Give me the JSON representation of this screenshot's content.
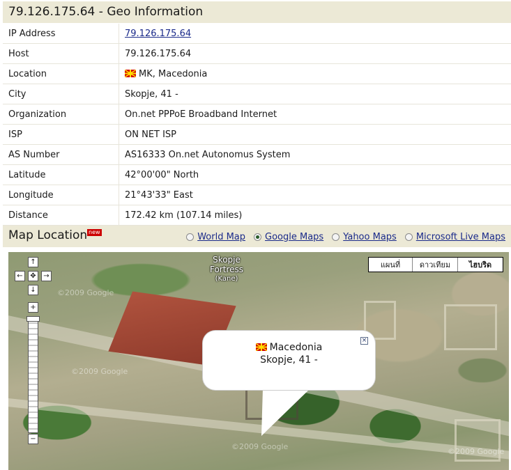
{
  "page_title": "79.126.175.64 - Geo Information",
  "info_rows": [
    {
      "label": "IP Address",
      "value": "79.126.175.64"
    },
    {
      "label": "Host",
      "value": "79.126.175.64"
    },
    {
      "label": "Location",
      "value": "MK, Macedonia"
    },
    {
      "label": "City",
      "value": "Skopje, 41 -"
    },
    {
      "label": "Organization",
      "value": "On.net PPPoE Broadband Internet"
    },
    {
      "label": "ISP",
      "value": "ON NET ISP"
    },
    {
      "label": "AS Number",
      "value": "AS16333 On.net Autonomus System"
    },
    {
      "label": "Latitude",
      "value": "42°00'00\" North"
    },
    {
      "label": "Longitude",
      "value": "21°43'33\" East"
    },
    {
      "label": "Distance",
      "value": "172.42 km (107.14 miles)"
    }
  ],
  "map_section": {
    "title": "Map Location",
    "badge": "new",
    "options": [
      {
        "label": "World Map",
        "checked": false
      },
      {
        "label": "Google Maps",
        "checked": true
      },
      {
        "label": "Yahoo Maps",
        "checked": false
      },
      {
        "label": "Microsoft Live Maps",
        "checked": false
      }
    ]
  },
  "map": {
    "type_buttons": [
      {
        "label": "แผนที่",
        "active": false
      },
      {
        "label": "ดาวเทียม",
        "active": false
      },
      {
        "label": "ไฮบริด",
        "active": true
      }
    ],
    "place_label": "Skopje Fortress",
    "place_sublabel": "(Kane)",
    "bubble_line1": "Macedonia",
    "bubble_line2": "Skopje, 41 -",
    "watermark": "©2009 Google",
    "nav": {
      "up": "↑",
      "down": "↓",
      "left": "←",
      "right": "→",
      "center": "✥",
      "zoom_in": "+",
      "zoom_out": "−"
    },
    "close_glyph": "×"
  },
  "colors": {
    "header_bg": "#ece9d6",
    "link": "#1a2a8a",
    "flag_red": "#d20000",
    "flag_yellow": "#ffdd00"
  }
}
